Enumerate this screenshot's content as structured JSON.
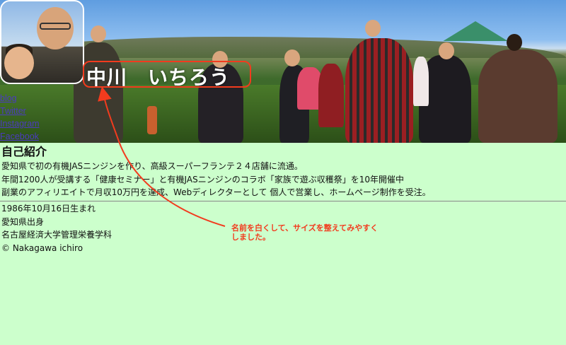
{
  "header": {
    "name": "中川　いちろう"
  },
  "nav": {
    "links": [
      "blog",
      "Twitter",
      "Instagram",
      "Facebook"
    ]
  },
  "intro": {
    "heading": "自己紹介",
    "lines": [
      "愛知県で初の有機JASニンジンを作り、高級スーパーフランテ２４店舗に流通。",
      "年間1200人が受講する「健康セミナー」と有機JASニンジンのコラボ「家族で遊ぶ収穫祭」を10年開催中",
      "副業のアフィリエイトで月収10万円を達成、Webディレクターとして 個人で営業し、ホームページ制作を受注。"
    ]
  },
  "profile": {
    "items": [
      "1986年10月16日生まれ",
      "愛知県出身",
      "名古屋経済大学管理栄養学科"
    ],
    "copyright": "© Nakagawa ichiro"
  },
  "annotation": {
    "text": "名前を白くして、サイズを整えてみやすくしました。"
  },
  "colors": {
    "background": "#ccffcc",
    "annotation": "#f23b1e",
    "link": "#4b3bbf"
  }
}
